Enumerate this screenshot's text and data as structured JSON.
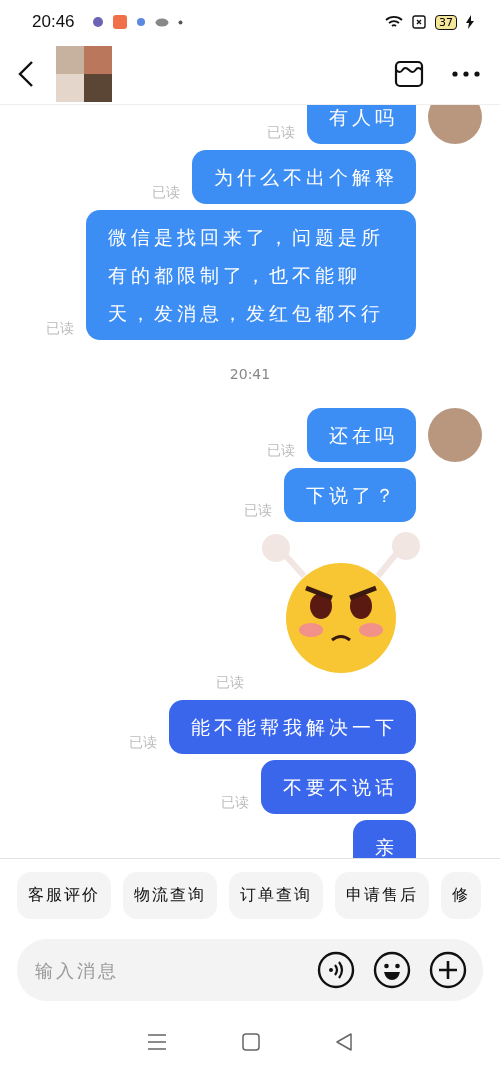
{
  "status_bar": {
    "time": "20:46",
    "battery": "37"
  },
  "messages": [
    {
      "kind": "text",
      "text": "有人吗",
      "read": "已读",
      "avatar": true,
      "color": "#3d8ef4"
    },
    {
      "kind": "text",
      "text": "为什么不出个解释",
      "read": "已读",
      "avatar": false,
      "color": "#3d8ef4"
    },
    {
      "kind": "text",
      "text": "微信是找回来了，问题是所有的都限制了，也不能聊天，发消息，发红包都不行",
      "read": "已读",
      "avatar": false,
      "color": "#3d8ef4"
    },
    {
      "kind": "time",
      "text": "20:41"
    },
    {
      "kind": "text",
      "text": "还在吗",
      "read": "已读",
      "avatar": true,
      "color": "#3d8ef4"
    },
    {
      "kind": "text",
      "text": "下说了？",
      "read": "已读",
      "avatar": false,
      "color": "#3d8ef4"
    },
    {
      "kind": "sticker",
      "read": "已读"
    },
    {
      "kind": "text",
      "text": "能不能帮我解决一下",
      "read": "已读",
      "avatar": false,
      "color": "#3a66ec"
    },
    {
      "kind": "text",
      "text": "不要不说话",
      "read": "已读",
      "avatar": false,
      "color": "#3a66ec"
    },
    {
      "kind": "text",
      "text": "亲",
      "avatar": false,
      "color": "#3a66ec"
    }
  ],
  "quick_replies": [
    "客服评价",
    "物流查询",
    "订单查询",
    "申请售后",
    "修"
  ],
  "input": {
    "placeholder": "输入消息"
  }
}
